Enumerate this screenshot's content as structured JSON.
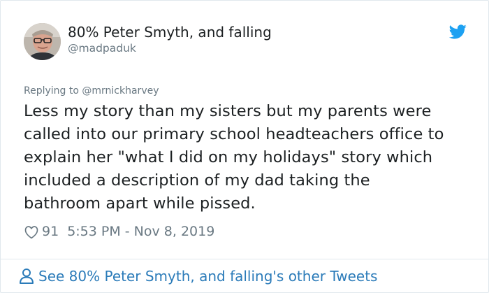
{
  "author": {
    "display_name": "80% Peter Smyth, and falling",
    "handle": "@madpaduk"
  },
  "reply": {
    "prefix": "Replying to",
    "mention": "@mrnickharvey"
  },
  "tweet": {
    "lines": [
      "Less my story than my sisters but my parents were",
      "called into our primary school headteachers office to",
      "explain her \"what I did on my holidays\" story which",
      "included a description of my dad taking the",
      "bathroom apart while pissed."
    ],
    "likes": "91",
    "timestamp": "5:53 PM - Nov 8, 2019"
  },
  "footer": {
    "link_text": "See 80% Peter Smyth, and falling's other Tweets"
  },
  "icons": {
    "brand": "twitter-bird-icon",
    "like": "heart-icon",
    "profile": "person-icon"
  },
  "colors": {
    "twitter_blue": "#1da1f2",
    "link_blue": "#2b7bb9",
    "secondary_text": "#697882",
    "primary_text": "#1c2022"
  }
}
